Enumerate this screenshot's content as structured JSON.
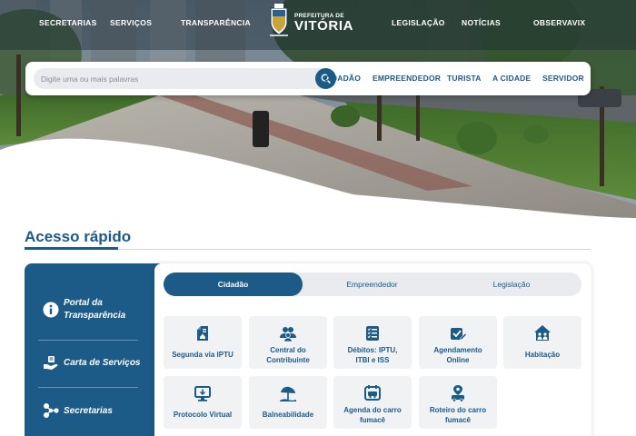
{
  "header": {
    "nav_left": [
      "SECRETARIAS",
      "SERVIÇOS",
      "TRANSPARÊNCIA"
    ],
    "nav_right": [
      "LEGISLAÇÃO",
      "NOTÍCIAS",
      "OBSERVAVIX"
    ],
    "logo_small": "PREFEITURA DE",
    "logo_big": "VITÓRIA"
  },
  "search": {
    "placeholder": "Digite uma ou mais palavras",
    "value": "",
    "icon": "search-icon",
    "profiles": [
      "CIDADÃO",
      "EMPREENDEDOR",
      "TURISTA",
      "A CIDADE",
      "SERVIDOR"
    ]
  },
  "quick_access": {
    "title": "Acesso rápido",
    "side_items": [
      {
        "label_line1": "Portal da",
        "label_line2": "Transparência",
        "icon": "info-icon"
      },
      {
        "label_line1": "Carta de Serviços",
        "label_line2": "",
        "icon": "hand-service-icon"
      },
      {
        "label_line1": "Secretarias",
        "label_line2": "",
        "icon": "network-icon"
      }
    ],
    "tabs": [
      "Cidadão",
      "Empreendedor",
      "Legislação"
    ],
    "active_tab": "Cidadão",
    "tiles": [
      {
        "line1": "Segunda via IPTU",
        "line2": "",
        "icon": "document-house-icon"
      },
      {
        "line1": "Central do",
        "line2": "Contribuinte",
        "icon": "people-icon"
      },
      {
        "line1": "Débitos: IPTU,",
        "line2": "ITBI e ISS",
        "icon": "checklist-icon"
      },
      {
        "line1": "Agendamento",
        "line2": "Online",
        "icon": "calendar-check-icon"
      },
      {
        "line1": "Habitação",
        "line2": "",
        "icon": "house-people-icon"
      },
      {
        "line1": "Protocolo Virtual",
        "line2": "",
        "icon": "monitor-icon"
      },
      {
        "line1": "Balneabilidade",
        "line2": "",
        "icon": "beach-umbrella-icon"
      },
      {
        "line1": "Agenda do carro",
        "line2": "fumacê",
        "icon": "van-calendar-icon"
      },
      {
        "line1": "Roteiro do carro",
        "line2": "fumacê",
        "icon": "van-location-icon"
      }
    ]
  },
  "colors": {
    "primary": "#1c5a88",
    "tile_bg": "#f1f2f4",
    "tab_bg": "#e9ebee"
  }
}
